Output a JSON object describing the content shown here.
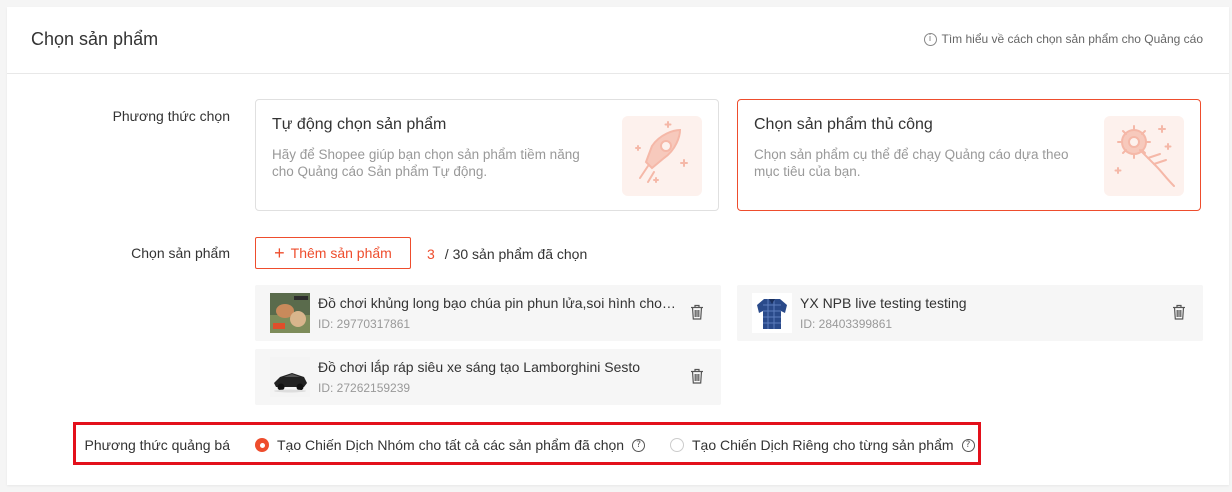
{
  "header": {
    "title": "Chọn sản phẩm",
    "help_link": "Tìm hiểu về cách chọn sản phẩm cho Quảng cáo"
  },
  "selection_method": {
    "label": "Phương thức chọn",
    "options": [
      {
        "title": "Tự động chọn sản phẩm",
        "description": "Hãy để Shopee giúp bạn chọn sản phẩm tiềm năng cho Quảng cáo Sản phẩm Tự động.",
        "selected": false,
        "illustration": "rocket-icon"
      },
      {
        "title": "Chọn sản phẩm thủ công",
        "description": "Chọn sản phẩm cụ thể để chạy Quảng cáo dựa theo mục tiêu của bạn.",
        "selected": true,
        "illustration": "gear-hand-icon"
      }
    ]
  },
  "product_select": {
    "label": "Chọn sản phẩm",
    "add_button": "Thêm sản phẩm",
    "selected_count": "3",
    "max_text": "/ 30 sản phẩm đã chọn"
  },
  "products": [
    {
      "name": "Đồ chơi khủng long bạo chúa pin phun lửa,soi hình cho bé ...",
      "id": "ID: 29770317861"
    },
    {
      "name": "YX NPB live testing testing",
      "id": "ID: 28403399861"
    },
    {
      "name": "Đồ chơi lắp ráp siêu xe sáng tạo Lamborghini Sesto",
      "id": "ID: 27262159239"
    }
  ],
  "promotion_method": {
    "label": "Phương thức quảng bá",
    "options": [
      {
        "label": "Tạo Chiến Dịch Nhóm cho tất cả các sản phẩm đã chọn",
        "selected": true
      },
      {
        "label": "Tạo Chiến Dịch Riêng cho từng sản phẩm",
        "selected": false
      }
    ]
  },
  "colors": {
    "accent": "#ee4d2d",
    "highlight": "#e3101b"
  }
}
